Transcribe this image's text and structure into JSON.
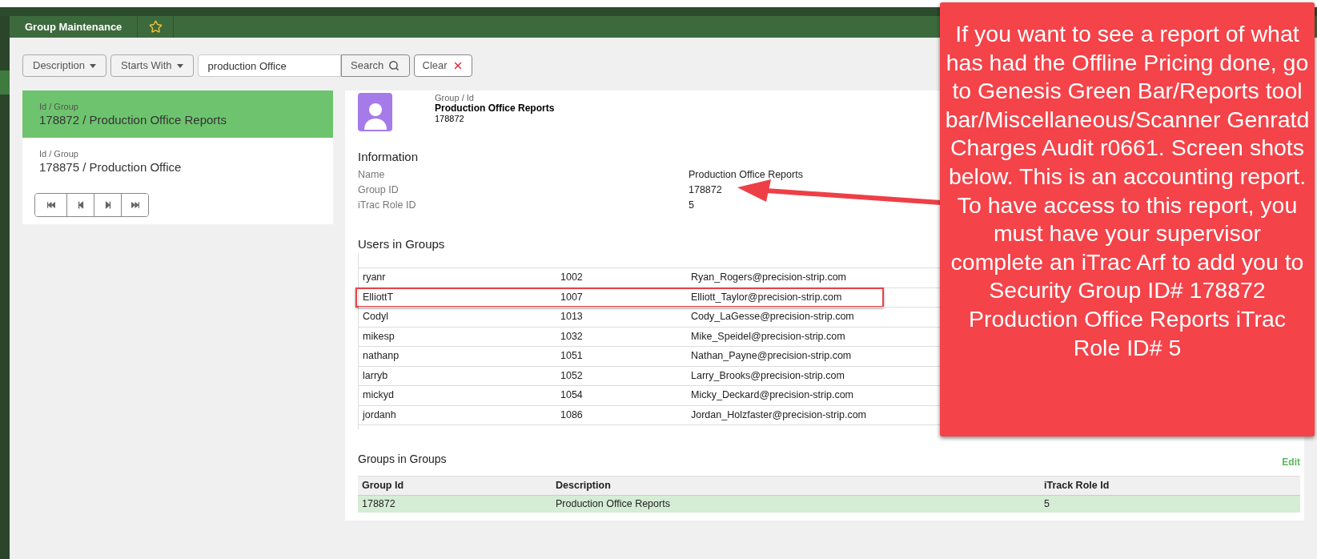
{
  "tabs": [
    {
      "label": "Group Maintenance",
      "selected": true
    }
  ],
  "toolbar": {
    "field_dropdown": "Description",
    "match_dropdown": "Starts With",
    "search": {
      "value": "production Office"
    },
    "search_button": "Search",
    "clear_button": "Clear"
  },
  "results": [
    {
      "caption": "Id / Group",
      "title": "178872 / Production Office Reports",
      "selected": true
    },
    {
      "caption": "Id / Group",
      "title": "178875 / Production Office",
      "selected": false
    }
  ],
  "detail": {
    "caption": "Group / Id",
    "title": "Production Office Reports",
    "id": "178872",
    "information": {
      "heading": "Information",
      "fields": [
        {
          "label": "Name",
          "value": "Production Office Reports"
        },
        {
          "label": "Group ID",
          "value": "178872"
        },
        {
          "label": "iTrac Role ID",
          "value": "5"
        }
      ]
    },
    "users": {
      "heading": "Users in Groups",
      "rows": [
        {
          "user": "ryanr",
          "id": "1002",
          "email": "Ryan_Rogers@precision-strip.com",
          "highlighted": false
        },
        {
          "user": "ElliottT",
          "id": "1007",
          "email": "Elliott_Taylor@precision-strip.com",
          "highlighted": true
        },
        {
          "user": "Codyl",
          "id": "1013",
          "email": "Cody_LaGesse@precision-strip.com",
          "highlighted": false
        },
        {
          "user": "mikesp",
          "id": "1032",
          "email": "Mike_Speidel@precision-strip.com",
          "highlighted": false
        },
        {
          "user": "nathanp",
          "id": "1051",
          "email": "Nathan_Payne@precision-strip.com",
          "highlighted": false
        },
        {
          "user": "larryb",
          "id": "1052",
          "email": "Larry_Brooks@precision-strip.com",
          "highlighted": false
        },
        {
          "user": "mickyd",
          "id": "1054",
          "email": "Micky_Deckard@precision-strip.com",
          "highlighted": false
        },
        {
          "user": "jordanh",
          "id": "1086",
          "email": "Jordan_Holzfaster@precision-strip.com",
          "highlighted": false
        }
      ]
    },
    "groups": {
      "heading": "Groups in Groups",
      "edit": "Edit",
      "columns": [
        "Group Id",
        "Description",
        "iTrack Role Id"
      ],
      "rows": [
        {
          "cells": [
            "178872",
            "Production Office Reports",
            "5"
          ],
          "selected": true
        }
      ]
    }
  },
  "callout": {
    "text": "If you want to see a report of what has had the Offline Pricing done, go to Genesis Green Bar/Reports tool bar/Miscellaneous/Scanner Genratd Charges Audit r0661. Screen shots below. This is an accounting report. To have access to this report, you must have your supervisor complete an iTrac Arf to add you to Security Group ID# 178872 Production Office Reports iTrac Role ID# 5"
  }
}
